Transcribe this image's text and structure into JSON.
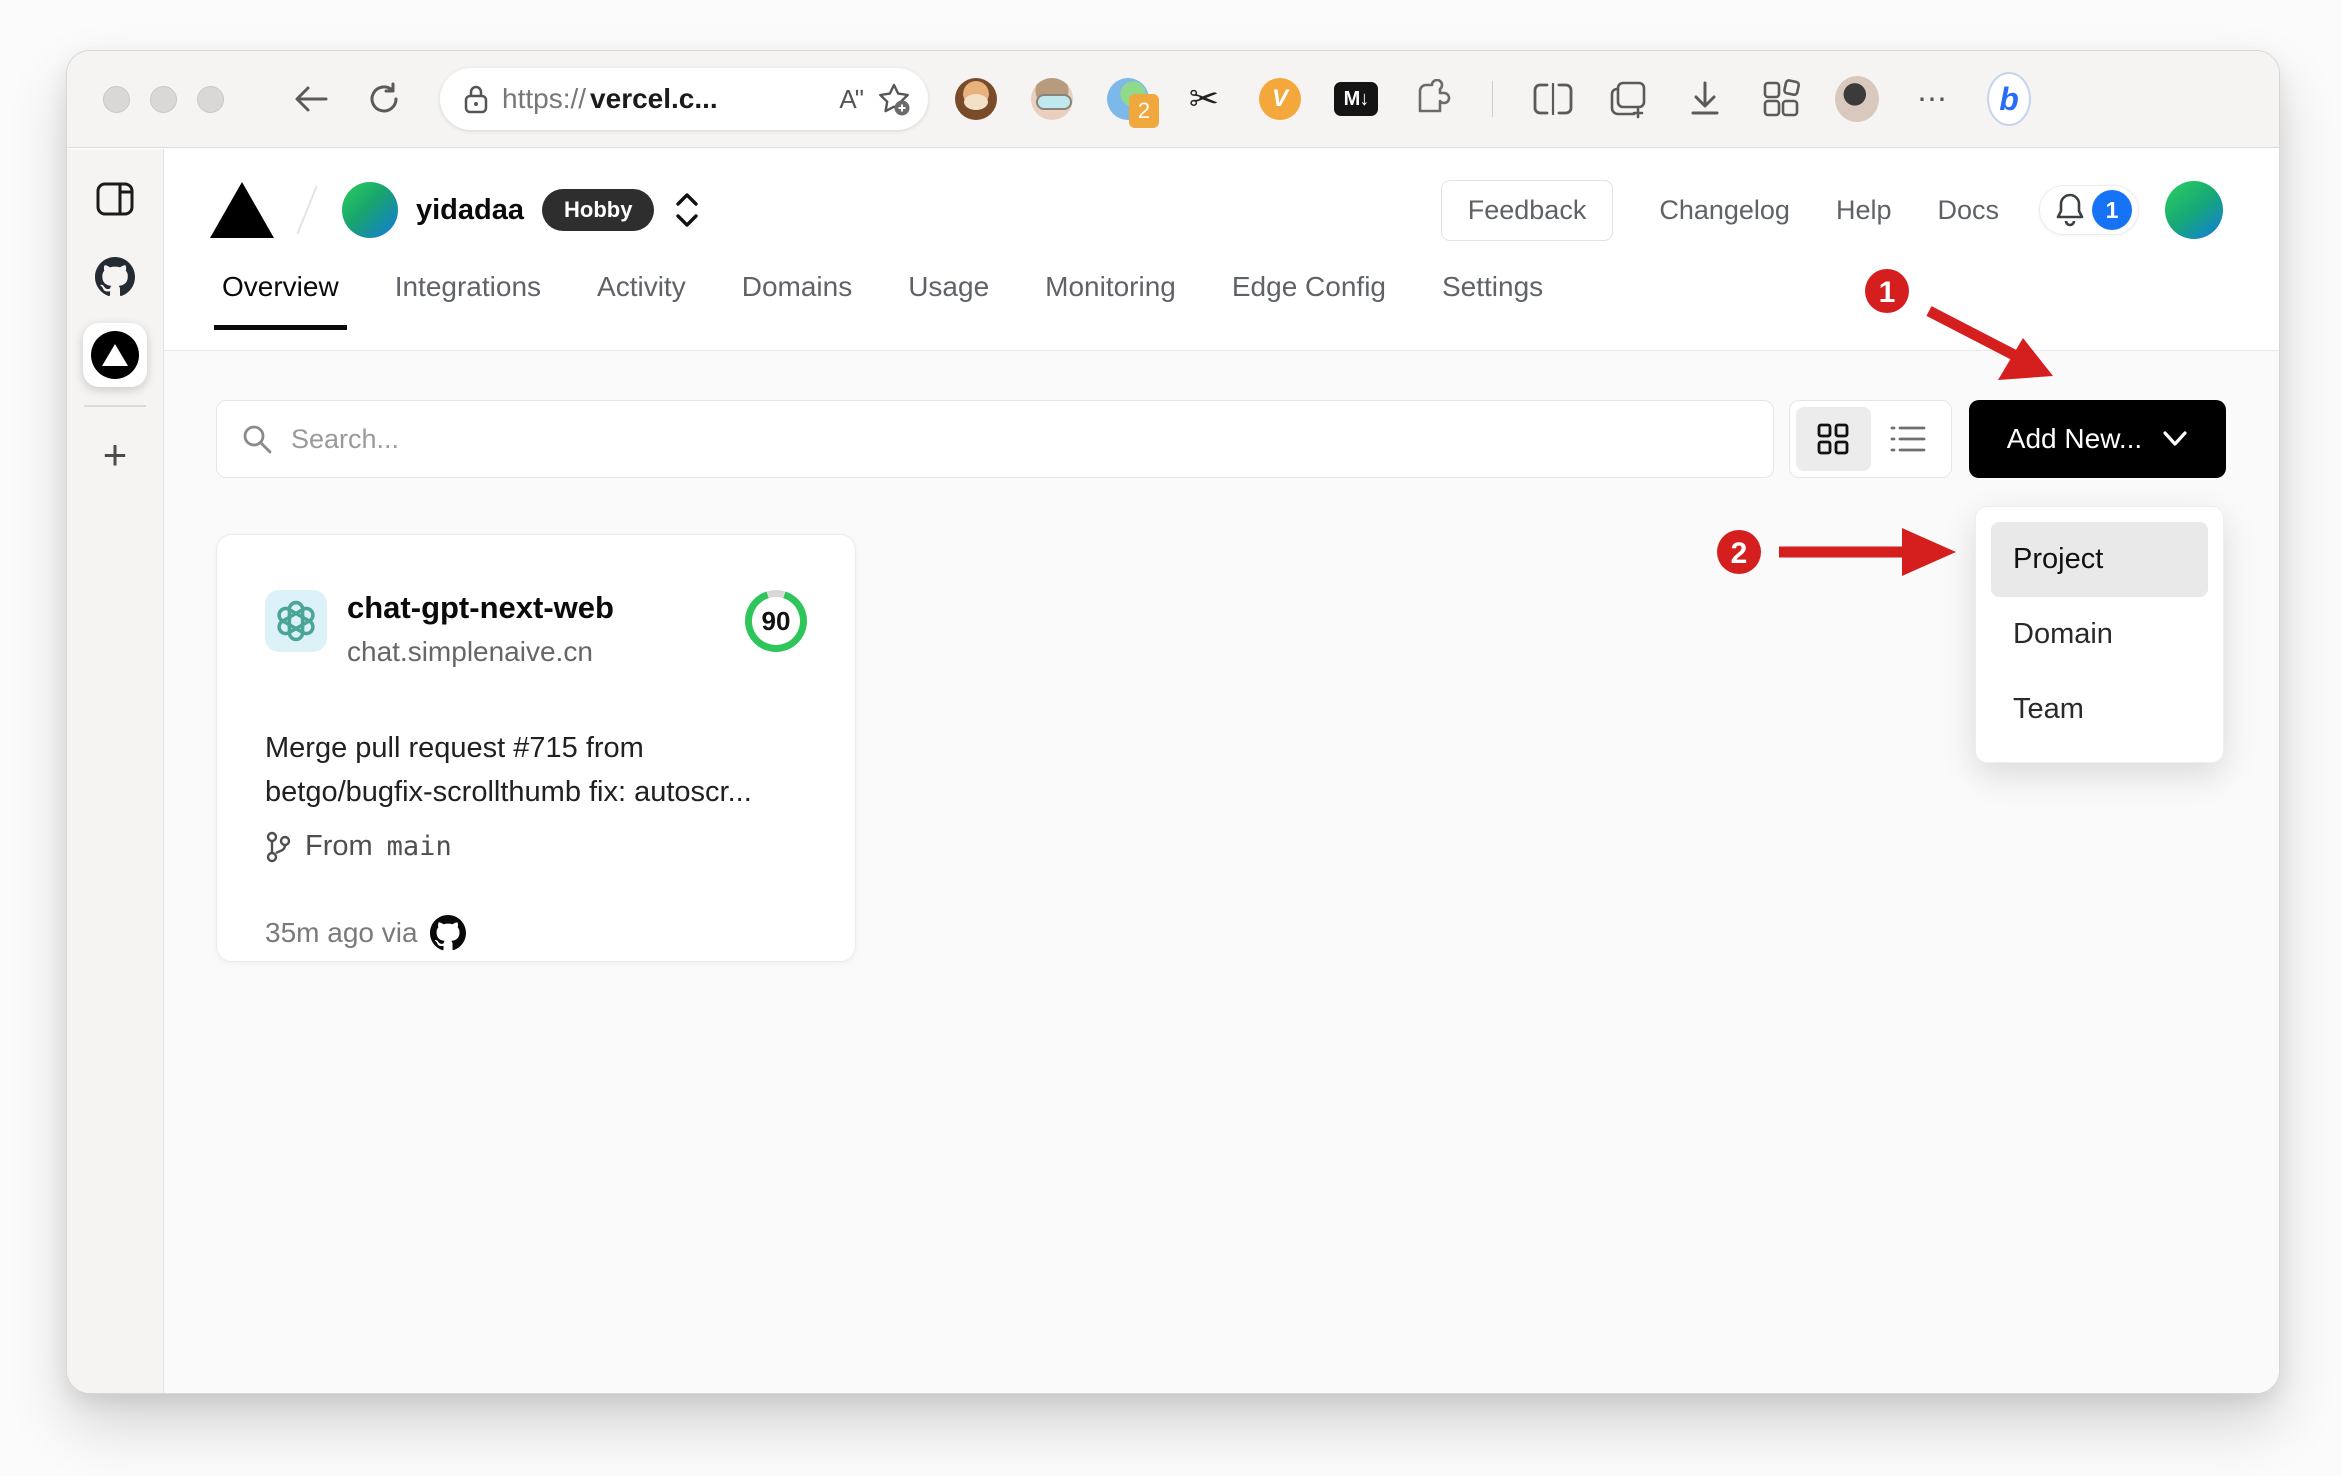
{
  "browser": {
    "url_scheme": "https://",
    "url_host": "vercel.c...",
    "reader_label": "Aʺ",
    "proxy_badge": "2",
    "v_ext_label": "V",
    "markdown_ext_label": "M↓",
    "more_label": "⋯",
    "bing_label": "b"
  },
  "header": {
    "team_name": "yidadaa",
    "plan_badge": "Hobby",
    "feedback_label": "Feedback",
    "changelog_label": "Changelog",
    "help_label": "Help",
    "docs_label": "Docs",
    "notification_count": "1"
  },
  "tabs": [
    {
      "label": "Overview",
      "active": true
    },
    {
      "label": "Integrations",
      "active": false
    },
    {
      "label": "Activity",
      "active": false
    },
    {
      "label": "Domains",
      "active": false
    },
    {
      "label": "Usage",
      "active": false
    },
    {
      "label": "Monitoring",
      "active": false
    },
    {
      "label": "Edge Config",
      "active": false
    },
    {
      "label": "Settings",
      "active": false
    }
  ],
  "toolbar": {
    "search_placeholder": "Search...",
    "add_new_label": "Add New..."
  },
  "dropdown": {
    "items": [
      "Project",
      "Domain",
      "Team"
    ],
    "highlighted": "Project"
  },
  "project_card": {
    "name": "chat-gpt-next-web",
    "domain": "chat.simplenaive.cn",
    "score": "90",
    "commit_message": "Merge pull request #715 from betgo/bugfix-scrollthumb fix: autoscr...",
    "from_label": "From",
    "branch": "main",
    "time_text": "35m ago via"
  },
  "annotations": {
    "step1": "1",
    "step2": "2"
  },
  "colors": {
    "annotation_red": "#d51f1f",
    "notification_blue": "#1673f6",
    "score_green": "#2ec55b",
    "plan_badge_dark": "#2e2e2e",
    "add_new_black": "#000000"
  }
}
